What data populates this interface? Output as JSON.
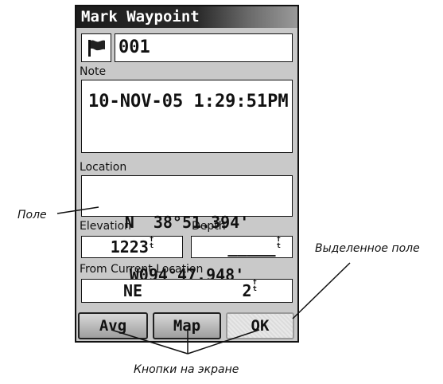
{
  "window": {
    "title": "Mark Waypoint"
  },
  "waypoint": {
    "name": "001",
    "icon": "flag-icon"
  },
  "note": {
    "label": "Note",
    "value": "10-NOV-05 1:29:51PM"
  },
  "location": {
    "label": "Location",
    "lat": "N  38°51.394'",
    "lon": "W094°47.948'"
  },
  "elevation": {
    "label": "Elevation",
    "value": "1223",
    "unit_top": "f",
    "unit_bottom": "t"
  },
  "depth": {
    "label": "Depth",
    "value": "_____",
    "unit_top": "f",
    "unit_bottom": "t"
  },
  "from_current": {
    "label": "From Current Location",
    "bearing": "NE",
    "distance": "2",
    "unit_top": "f",
    "unit_bottom": "t"
  },
  "buttons": {
    "avg": "Avg",
    "map": "Map",
    "ok": "OK",
    "selected": "ok"
  },
  "callouts": {
    "field": "Поле",
    "selected_field": "Выделенное поле",
    "onscreen_buttons": "Кнопки на экране"
  }
}
